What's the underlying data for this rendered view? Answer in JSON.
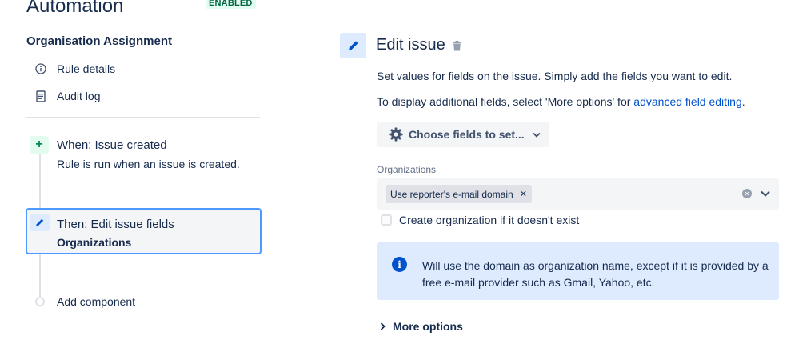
{
  "header": {
    "title": "Automation",
    "status_badge": "ENABLED"
  },
  "sidebar": {
    "rule_name": "Organisation Assignment",
    "nav": [
      {
        "label": "Rule details",
        "icon": "info-icon"
      },
      {
        "label": "Audit log",
        "icon": "document-icon"
      }
    ],
    "trigger": {
      "title": "When: Issue created",
      "description": "Rule is run when an issue is created."
    },
    "action": {
      "title": "Then: Edit issue fields",
      "subtitle": "Organizations"
    },
    "add_component_label": "Add component"
  },
  "panel": {
    "title": "Edit issue",
    "description": "Set values for fields on the issue. Simply add the fields you want to edit.",
    "description2_prefix": "To display additional fields, select 'More options' for ",
    "description2_link": "advanced field editing",
    "description2_suffix": ".",
    "choose_fields_label": "Choose fields to set...",
    "field_label": "Organizations",
    "selected_tag": "Use reporter's e-mail domain",
    "checkbox_label": "Create organization if it doesn't exist",
    "checkbox_checked": false,
    "info_message": "Will use the domain as organization name, except if it is provided by a free e-mail provider such as Gmail, Yahoo, etc.",
    "more_options_label": "More options"
  },
  "colors": {
    "accent": "#0052cc",
    "selected_border": "#4c9aff",
    "info_bg": "#deebff",
    "badge_bg": "#e3fcef",
    "badge_text": "#006644"
  }
}
